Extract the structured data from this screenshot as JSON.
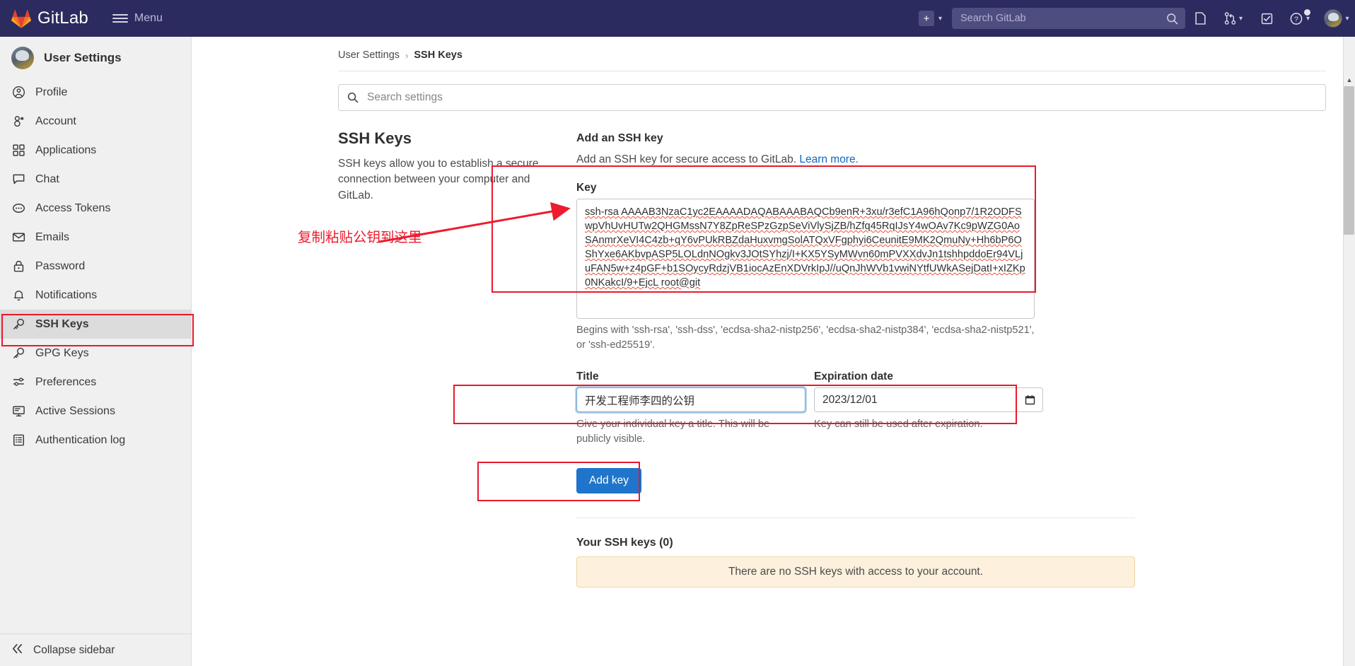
{
  "topnav": {
    "brand": "GitLab",
    "menu_label": "Menu",
    "plus_icon": "plus-square-icon",
    "search_placeholder": "Search GitLab",
    "search_value": "",
    "search_icon": "search-icon",
    "icons": [
      {
        "name": "issues-icon",
        "glyph": "issues"
      },
      {
        "name": "merge-requests-icon",
        "glyph": "merge"
      },
      {
        "name": "todos-icon",
        "glyph": "todo"
      },
      {
        "name": "help-icon",
        "glyph": "help"
      }
    ],
    "avatar": "user-avatar"
  },
  "sidebar": {
    "title": "User Settings",
    "avatar": "user-avatar",
    "items": [
      {
        "label": "Profile",
        "icon": "profile-icon",
        "active": false
      },
      {
        "label": "Account",
        "icon": "account-icon",
        "active": false
      },
      {
        "label": "Applications",
        "icon": "applications-icon",
        "active": false
      },
      {
        "label": "Chat",
        "icon": "chat-icon",
        "active": false
      },
      {
        "label": "Access Tokens",
        "icon": "access-tokens-icon",
        "active": false
      },
      {
        "label": "Emails",
        "icon": "emails-icon",
        "active": false
      },
      {
        "label": "Password",
        "icon": "password-lock-icon",
        "active": false
      },
      {
        "label": "Notifications",
        "icon": "notifications-bell-icon",
        "active": false
      },
      {
        "label": "SSH Keys",
        "icon": "ssh-key-icon",
        "active": true
      },
      {
        "label": "GPG Keys",
        "icon": "gpg-key-icon",
        "active": false
      },
      {
        "label": "Preferences",
        "icon": "preferences-sliders-icon",
        "active": false
      },
      {
        "label": "Active Sessions",
        "icon": "active-sessions-monitor-icon",
        "active": false
      },
      {
        "label": "Authentication log",
        "icon": "authentication-log-icon",
        "active": false
      }
    ],
    "collapse_label": "Collapse sidebar",
    "collapse_icon": "chevron-double-left-icon"
  },
  "breadcrumb": {
    "parent": "User Settings",
    "separator": "›",
    "current": "SSH Keys"
  },
  "settings_search": {
    "placeholder": "Search settings",
    "value": "",
    "icon": "search-icon"
  },
  "left_panel": {
    "heading": "SSH Keys",
    "description": "SSH keys allow you to establish a secure connection between your computer and GitLab."
  },
  "form": {
    "heading": "Add an SSH key",
    "subtitle": "Add an SSH key for secure access to GitLab.",
    "learn_more": "Learn more.",
    "key_label": "Key",
    "key_value": "ssh-rsa AAAAB3NzaC1yc2EAAAADAQABAAABAQCb9enR+3xu/r3efC1A96hQonp7/1R2ODFSwpVhUvHUTw2QHGMssN7Y8ZpReSPzGzpSeViVlySjZB/hZfq45RqIJsY4wOAv7Kc9pWZG0AoSAnmrXeVI4C4zb+qY6vPUkRBZdaHuxvmgSolATQxVFgphyi6CeunitE9MK2QmuNy+Hh6bP6OShYxe6AKbvpASP5LOLdnNOgkv3JOtSYhzj/I+KX5YSyMWvn60mPVXXdvJn1tshhpddoEr94VLjuFAN5w+z4pGF+b1SOycyRdzjVB1iocAzEnXDVrkIpJ//uQnJhWVb1vwiNYtfUWkASejDatI+xIZKp0NKakcI/9+EjcL root@git",
    "key_hint": "Begins with 'ssh-rsa', 'ssh-dss', 'ecdsa-sha2-nistp256', 'ecdsa-sha2-nistp384', 'ecdsa-sha2-nistp521', or 'ssh-ed25519'.",
    "title_label": "Title",
    "title_value": "开发工程师李四的公钥",
    "title_hint": "Give your individual key a title. This will be publicly visible.",
    "expiration_label": "Expiration date",
    "expiration_value": "2023/12/01",
    "expiration_hint": "Key can still be used after expiration.",
    "expiration_icon": "calendar-icon",
    "submit_label": "Add key"
  },
  "keys_list": {
    "heading": "Your SSH keys (0)",
    "empty_message": "There are no SSH keys with access to your account."
  },
  "annotations": {
    "paste_note": "复制粘贴公钥到这里",
    "color": "#e8192c"
  }
}
